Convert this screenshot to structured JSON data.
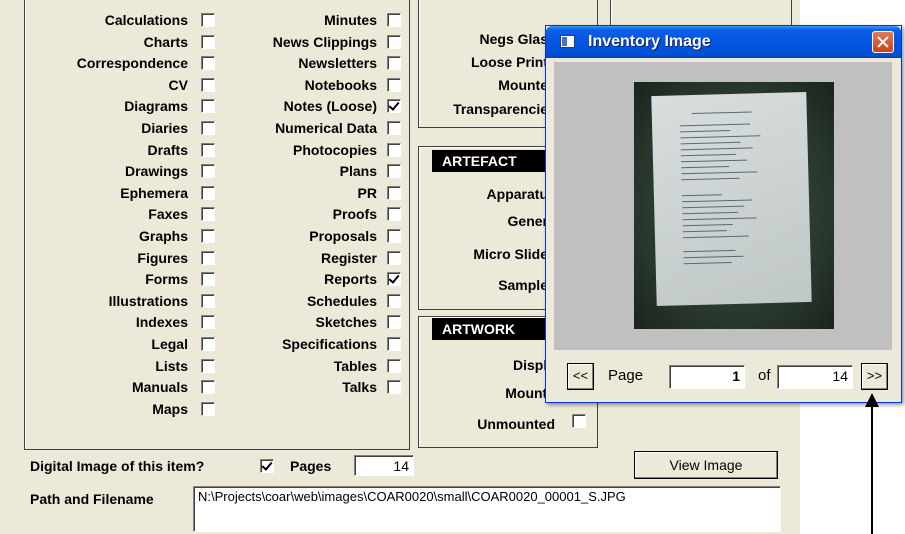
{
  "form": {
    "col1": [
      "Calculations",
      "Charts",
      "Correspondence",
      "CV",
      "Diagrams",
      "Diaries",
      "Drafts",
      "Drawings",
      "Ephemera",
      "Faxes",
      "Graphs",
      "Figures",
      "Forms",
      "Illustrations",
      "Indexes",
      "Legal",
      "Lists",
      "Manuals",
      "Maps"
    ],
    "col1_checked": [
      false,
      false,
      false,
      false,
      false,
      false,
      false,
      false,
      false,
      false,
      false,
      false,
      false,
      false,
      false,
      false,
      false,
      false,
      false
    ],
    "col2": [
      "Minutes",
      "News Clippings",
      "Newsletters",
      "Notebooks",
      "Notes (Loose)",
      "Numerical Data",
      "Photocopies",
      "Plans",
      "PR",
      "Proofs",
      "Proposals",
      "Register",
      "Reports",
      "Schedules",
      "Sketches",
      "Specifications",
      "Tables",
      "Talks"
    ],
    "col2_checked": [
      false,
      false,
      false,
      false,
      true,
      false,
      false,
      false,
      false,
      false,
      false,
      false,
      true,
      false,
      false,
      false,
      false,
      false
    ],
    "col3": [
      "Negs Glas",
      "Loose Print",
      "Mounte",
      "Transparencie"
    ],
    "artefact_header": "ARTEFACT",
    "artefact_items": [
      "Apparatu",
      "Gener",
      "Micro Slide",
      "Sample"
    ],
    "artwork_header": "ARTWORK",
    "artwork_items": [
      "Displa",
      "Mounte",
      "Unmounted"
    ],
    "digital_label": "Digital Image of this item?",
    "digital_checked": true,
    "pages_label": "Pages",
    "pages_value": "14",
    "view_image_label": "View Image",
    "path_label": "Path and Filename",
    "path_value": "N:\\Projects\\coar\\web\\images\\COAR0020\\small\\COAR0020_00001_S.JPG"
  },
  "popup": {
    "title": "Inventory Image",
    "prev_label": "<<",
    "next_label": ">>",
    "page_label": "Page",
    "page_value": "1",
    "of_label": "of",
    "total_value": "14"
  },
  "colors": {
    "titlebar": "#0454e0",
    "form_bg": "#ece9d8"
  }
}
